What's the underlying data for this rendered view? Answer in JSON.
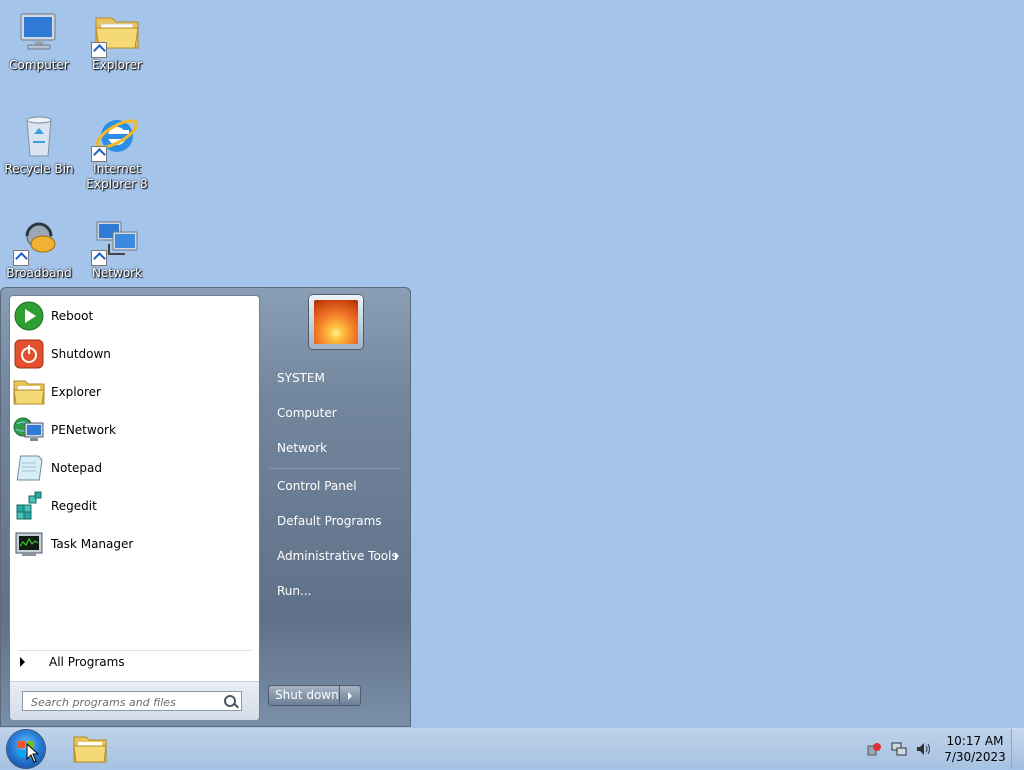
{
  "desktop": {
    "icons": [
      {
        "label": "Computer",
        "icon": "computer-icon"
      },
      {
        "label": "Explorer",
        "icon": "folder-icon"
      },
      {
        "label": "Recycle Bin",
        "icon": "recycle-bin-icon"
      },
      {
        "label": "Internet Explorer 8",
        "icon": "internet-explorer-icon"
      },
      {
        "label": "Broadband",
        "icon": "broadband-icon"
      },
      {
        "label": "Network",
        "icon": "network-icon"
      }
    ]
  },
  "start_menu": {
    "programs": [
      {
        "label": "Reboot",
        "icon": "reboot-icon"
      },
      {
        "label": "Shutdown",
        "icon": "shutdown-icon"
      },
      {
        "label": "Explorer",
        "icon": "folder-icon"
      },
      {
        "label": "PENetwork",
        "icon": "network-globe-icon"
      },
      {
        "label": "Notepad",
        "icon": "notepad-icon"
      },
      {
        "label": "Regedit",
        "icon": "regedit-icon"
      },
      {
        "label": "Task Manager",
        "icon": "task-manager-icon"
      }
    ],
    "all_programs": "All Programs",
    "search_placeholder": "Search programs and files",
    "right_links": [
      "SYSTEM",
      "Computer",
      "Network",
      "Control Panel",
      "Default Programs",
      "Administrative Tools",
      "Run..."
    ],
    "shutdown_label": "Shut down"
  },
  "taskbar": {
    "time": "10:17 AM",
    "date": "7/30/2023"
  },
  "colors": {
    "desktop_bg": "#a4c4ea",
    "start_menu_right": "#6b7e95",
    "taskbar": "#b3cbe7"
  }
}
